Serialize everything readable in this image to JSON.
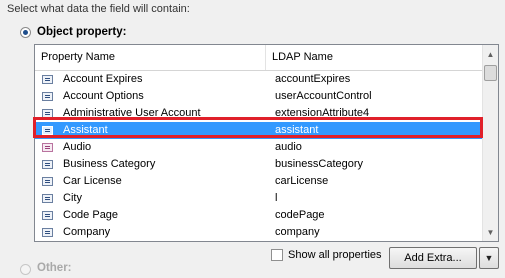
{
  "prompt": "Select what data the field will contain:",
  "object_property": {
    "label": "Object property:",
    "selected": true
  },
  "other": {
    "label": "Other:",
    "selected": false
  },
  "table": {
    "columns": [
      "Property Name",
      "LDAP Name"
    ],
    "rows": [
      {
        "name": "Account Expires",
        "ldap": "accountExpires",
        "icon": "attribute-icon"
      },
      {
        "name": "Account Options",
        "ldap": "userAccountControl",
        "icon": "attribute-icon"
      },
      {
        "name": "Administrative User Account",
        "ldap": "extensionAttribute4",
        "icon": "attribute-icon"
      },
      {
        "name": "Assistant",
        "ldap": "assistant",
        "icon": "attribute-icon",
        "selected": true
      },
      {
        "name": "Audio",
        "ldap": "audio",
        "icon": "audio-attribute-icon"
      },
      {
        "name": "Business Category",
        "ldap": "businessCategory",
        "icon": "attribute-icon"
      },
      {
        "name": "Car License",
        "ldap": "carLicense",
        "icon": "attribute-icon"
      },
      {
        "name": "City",
        "ldap": "l",
        "icon": "attribute-icon"
      },
      {
        "name": "Code Page",
        "ldap": "codePage",
        "icon": "attribute-icon"
      },
      {
        "name": "Company",
        "ldap": "company",
        "icon": "attribute-icon"
      }
    ]
  },
  "show_all": {
    "label": "Show all properties",
    "checked": false
  },
  "add_extra": {
    "label": "Add Extra..."
  },
  "colors": {
    "selection": "#3399ff",
    "highlight_border": "#e0202a"
  }
}
